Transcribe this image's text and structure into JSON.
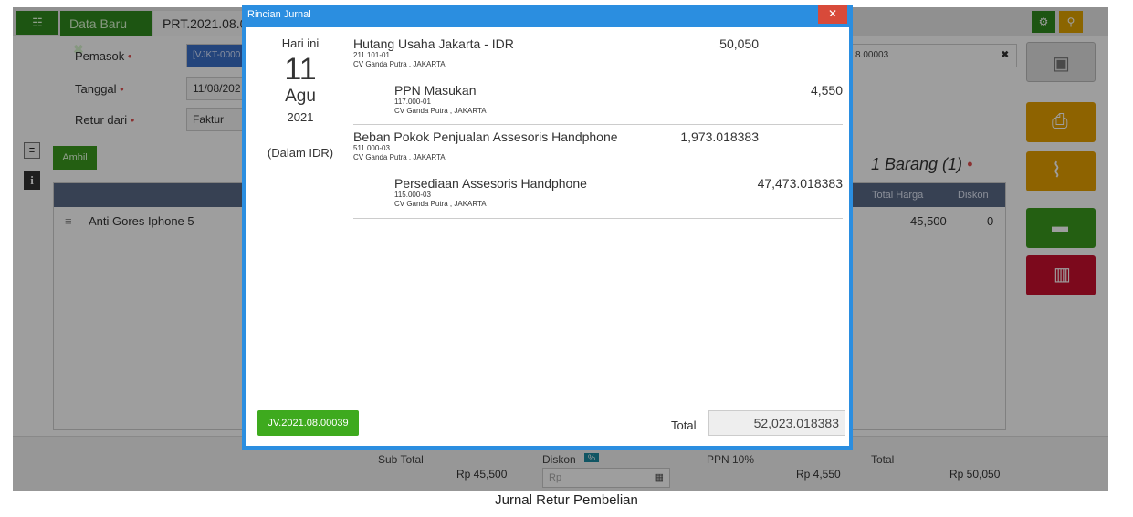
{
  "background_app": {
    "tabs": [
      {
        "label": "Data Baru",
        "close": "✖"
      },
      {
        "label": "PRT.2021.08.0"
      }
    ],
    "form": {
      "supplier_label": "Pemasok",
      "supplier_value": "[VJKT-0000",
      "supplier_right_value": "8.00003",
      "supplier_clear": "✖",
      "date_label": "Tanggal",
      "date_value": "11/08/202",
      "return_from_label": "Retur dari",
      "return_from_value": "Faktur",
      "required_mark": "•"
    },
    "take_button": "Ambil",
    "items_summary": "1 Barang (1)",
    "grid": {
      "columns": [
        "Total Harga",
        "Diskon"
      ],
      "rows": [
        {
          "name": "Anti Gores Iphone 5",
          "total": "45,500",
          "discount": "0"
        }
      ]
    },
    "summary": {
      "subtotal_label": "Sub Total",
      "subtotal_value": "Rp 45,500",
      "discount_label": "Diskon",
      "discount_badge": "%",
      "discount_placeholder": "Rp",
      "ppn_label": "PPN 10%",
      "ppn_value": "Rp 4,550",
      "total_label": "Total",
      "total_value": "Rp 50,050"
    },
    "icons": [
      "list-icon",
      "gear-icon",
      "pin-icon",
      "save-icon",
      "print-icon",
      "attachment-icon",
      "briefcase-icon",
      "trash-icon",
      "document-icon",
      "info-icon"
    ]
  },
  "modal": {
    "title": "Rincian Jurnal",
    "close": "✕",
    "date": {
      "today": "Hari ini",
      "day": "11",
      "month": "Agu",
      "year": "2021",
      "currency": "(Dalam IDR)"
    },
    "entries": [
      {
        "title": "Hutang Usaha Jakarta - IDR",
        "code": "211.101-01",
        "location": "CV Ganda Putra , JAKARTA",
        "amount": "50,050",
        "side": "debit"
      },
      {
        "title": "PPN Masukan",
        "code": "117.000-01",
        "location": "CV Ganda Putra , JAKARTA",
        "amount": "4,550",
        "side": "credit"
      },
      {
        "title": "Beban Pokok Penjualan Assesoris Handphone",
        "code": "511.000-03",
        "location": "CV Ganda Putra , JAKARTA",
        "amount": "1,973.018383",
        "side": "debit"
      },
      {
        "title": "Persediaan Assesoris Handphone",
        "code": "115.000-03",
        "location": "CV Ganda Putra , JAKARTA",
        "amount": "47,473.018383",
        "side": "credit"
      }
    ],
    "journal_number": "JV.2021.08.00039",
    "total_label": "Total",
    "total_value": "52,023.018383"
  },
  "caption": "Jurnal Retur Pembelian"
}
